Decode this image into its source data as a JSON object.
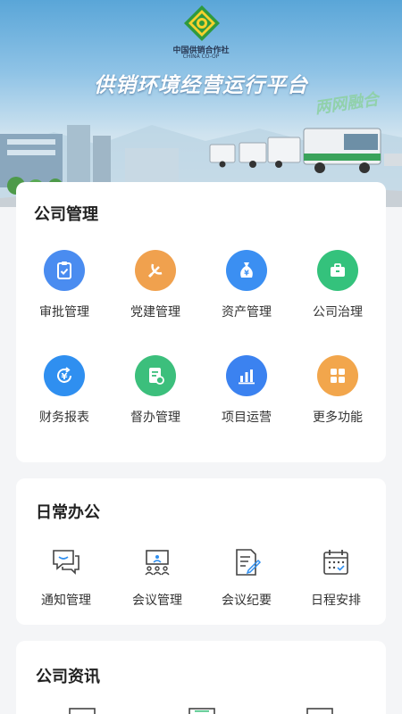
{
  "banner": {
    "org_cn": "中国供销合作社",
    "org_en": "CHINA CO-OP",
    "title": "供销环境经营运行平台",
    "tag": "两网融合"
  },
  "company_management": {
    "title": "公司管理",
    "items": [
      {
        "label": "审批管理",
        "icon": "approval-clipboard-icon",
        "color": "#4a8cf0"
      },
      {
        "label": "党建管理",
        "icon": "party-emblem-icon",
        "color": "#f0a14e"
      },
      {
        "label": "资产管理",
        "icon": "money-bag-icon",
        "color": "#3b8ff2"
      },
      {
        "label": "公司治理",
        "icon": "briefcase-icon",
        "color": "#34c27c"
      },
      {
        "label": "财务报表",
        "icon": "yuan-refresh-icon",
        "color": "#2f8ff0"
      },
      {
        "label": "督办管理",
        "icon": "supervise-document-icon",
        "color": "#3cbf7c"
      },
      {
        "label": "项目运营",
        "icon": "bar-chart-icon",
        "color": "#3b82f0"
      },
      {
        "label": "更多功能",
        "icon": "grid-more-icon",
        "color": "#f2a64c"
      }
    ]
  },
  "daily_office": {
    "title": "日常办公",
    "items": [
      {
        "label": "通知管理",
        "icon": "notification-chat-icon"
      },
      {
        "label": "会议管理",
        "icon": "meeting-board-icon"
      },
      {
        "label": "会议纪要",
        "icon": "minutes-edit-icon"
      },
      {
        "label": "日程安排",
        "icon": "calendar-icon"
      }
    ]
  },
  "company_news": {
    "title": "公司资讯"
  }
}
